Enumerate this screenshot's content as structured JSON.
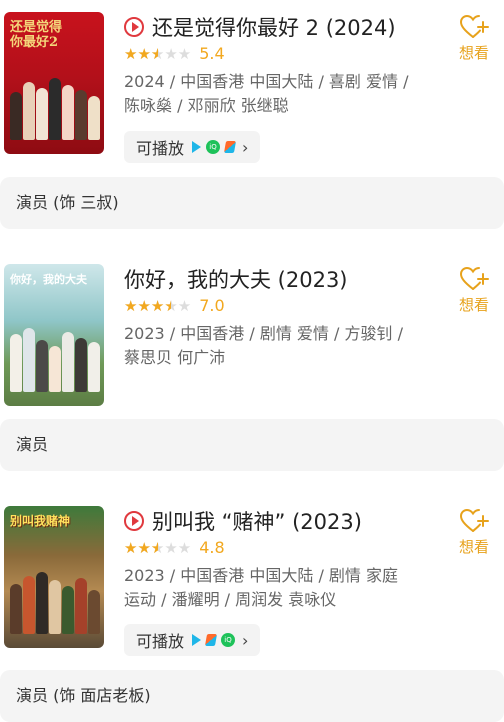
{
  "movies": [
    {
      "poster_text": "还是觉得\n你最好2",
      "title": "还是觉得你最好 2 (2024)",
      "rating": 5.4,
      "rating_fraction": 0.5,
      "score": "5.4",
      "meta": "2024 / 中国香港 中国大陆 / 喜剧 爱情 / 陈咏燊 / 邓丽欣 张继聪",
      "playable_label": "可播放",
      "platform_icons": [
        "tencent-video-icon",
        "iqiyi-icon",
        "youku-icon"
      ],
      "want_label": "想看",
      "role": "演员 (饰 三叔)"
    },
    {
      "poster_text": "你好，我的大夫",
      "title": "你好，我的大夫 (2023)",
      "rating": 7.0,
      "rating_fraction": 0.7,
      "score": "7.0",
      "meta": "2023 / 中国香港 / 剧情 爱情 / 方骏钊 / 蔡思贝 何广沛",
      "want_label": "想看",
      "role": "演员"
    },
    {
      "poster_text": "别叫我赌神",
      "title": "别叫我 “赌神” (2023)",
      "rating": 4.8,
      "rating_fraction": 0.5,
      "score": "4.8",
      "meta": "2023 / 中国香港 中国大陆 / 剧情 家庭 运动 / 潘耀明 / 周润发 袁咏仪",
      "playable_label": "可播放",
      "platform_icons": [
        "tencent-video-icon",
        "youku-icon",
        "iqiyi-icon"
      ],
      "want_label": "想看",
      "role": "演员 (饰 面店老板)"
    }
  ],
  "colors": {
    "accent": "#e7a21c",
    "star": "#f2a81f",
    "play_badge": "#e0393e"
  }
}
